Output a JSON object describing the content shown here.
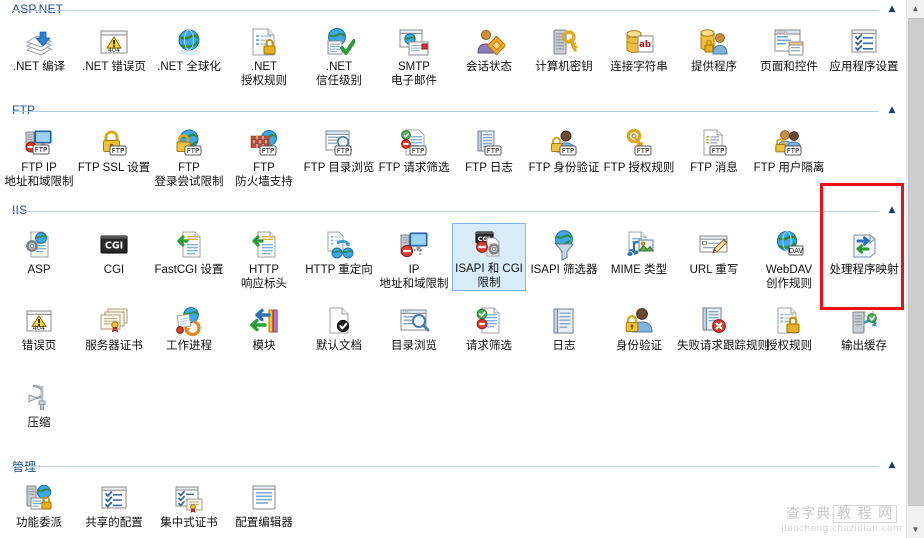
{
  "window": {
    "app": "IIS Manager Features View",
    "scrollbar": {
      "up_arrow": "▲",
      "down_arrow": "▼"
    }
  },
  "collapse_chevron": "▲",
  "groups": [
    {
      "id": "aspnet",
      "title": "ASP.NET",
      "items": [
        {
          "label": ".NET 编译",
          "icon": "net-compile-icon"
        },
        {
          "label": ".NET 错误页",
          "icon": "net-error-page-icon"
        },
        {
          "label": ".NET 全球化",
          "icon": "net-globalization-icon"
        },
        {
          "label": ".NET 授权规则",
          "icon": "net-authorization-rules-icon"
        },
        {
          "label": ".NET 信任级别",
          "icon": "net-trust-levels-icon"
        },
        {
          "label": "SMTP 电子邮件",
          "icon": "smtp-email-icon"
        },
        {
          "label": "会话状态",
          "icon": "session-state-icon"
        },
        {
          "label": "计算机密钥",
          "icon": "machine-key-icon"
        },
        {
          "label": "连接字符串",
          "icon": "connection-strings-icon"
        },
        {
          "label": "提供程序",
          "icon": "providers-icon"
        },
        {
          "label": "页面和控件",
          "icon": "pages-and-controls-icon"
        },
        {
          "label": "应用程序设置",
          "icon": "application-settings-icon"
        }
      ]
    },
    {
      "id": "ftp",
      "title": "FTP",
      "items": [
        {
          "label": "FTP IP 地址和域限制",
          "icon": "ftp-ip-address-domain-restrictions-icon"
        },
        {
          "label": "FTP SSL 设置",
          "icon": "ftp-ssl-settings-icon"
        },
        {
          "label": "FTP 登录尝试限制",
          "icon": "ftp-logon-attempt-restrictions-icon"
        },
        {
          "label": "FTP 防火墙支持",
          "icon": "ftp-firewall-support-icon"
        },
        {
          "label": "FTP 目录浏览",
          "icon": "ftp-directory-browsing-icon"
        },
        {
          "label": "FTP 请求筛选",
          "icon": "ftp-request-filtering-icon"
        },
        {
          "label": "FTP 日志",
          "icon": "ftp-logging-icon"
        },
        {
          "label": "FTP 身份验证",
          "icon": "ftp-authentication-icon"
        },
        {
          "label": "FTP 授权规则",
          "icon": "ftp-authorization-rules-icon"
        },
        {
          "label": "FTP 消息",
          "icon": "ftp-messages-icon"
        },
        {
          "label": "FTP 用户隔离",
          "icon": "ftp-user-isolation-icon"
        }
      ]
    },
    {
      "id": "iis",
      "title": "IIS",
      "items": [
        {
          "label": "ASP",
          "icon": "asp-icon"
        },
        {
          "label": "CGI",
          "icon": "cgi-icon"
        },
        {
          "label": "FastCGI 设置",
          "icon": "fastcgi-settings-icon"
        },
        {
          "label": "HTTP 响应标头",
          "icon": "http-response-headers-icon"
        },
        {
          "label": "HTTP 重定向",
          "icon": "http-redirect-icon"
        },
        {
          "label": "IP 地址和域限制",
          "icon": "ip-address-domain-restrictions-icon"
        },
        {
          "label": "ISAPI 和 CGI 限制",
          "icon": "isapi-cgi-restrictions-icon",
          "selected": true
        },
        {
          "label": "ISAPI 筛选器",
          "icon": "isapi-filters-icon"
        },
        {
          "label": "MIME 类型",
          "icon": "mime-types-icon"
        },
        {
          "label": "URL 重写",
          "icon": "url-rewrite-icon"
        },
        {
          "label": "WebDAV 创作规则",
          "icon": "webdav-authoring-rules-icon"
        },
        {
          "label": "处理程序映射",
          "icon": "handler-mappings-icon",
          "highlighted": true
        },
        {
          "label": "错误页",
          "icon": "error-pages-icon"
        },
        {
          "label": "服务器证书",
          "icon": "server-certificates-icon"
        },
        {
          "label": "工作进程",
          "icon": "worker-processes-icon"
        },
        {
          "label": "模块",
          "icon": "modules-icon"
        },
        {
          "label": "默认文档",
          "icon": "default-document-icon"
        },
        {
          "label": "目录浏览",
          "icon": "directory-browsing-icon"
        },
        {
          "label": "请求筛选",
          "icon": "request-filtering-icon"
        },
        {
          "label": "日志",
          "icon": "logging-icon"
        },
        {
          "label": "身份验证",
          "icon": "authentication-icon"
        },
        {
          "label": "失败请求跟踪规则",
          "icon": "failed-request-tracing-rules-icon"
        },
        {
          "label": "授权规则",
          "icon": "authorization-rules-icon"
        },
        {
          "label": "输出缓存",
          "icon": "output-caching-icon"
        },
        {
          "label": "压缩",
          "icon": "compression-icon"
        }
      ]
    },
    {
      "id": "manage",
      "title": "管理",
      "items": [
        {
          "label": "功能委派",
          "icon": "feature-delegation-icon"
        },
        {
          "label": "共享的配置",
          "icon": "shared-configuration-icon"
        },
        {
          "label": "集中式证书",
          "icon": "centralized-certificates-icon"
        },
        {
          "label": "配置编辑器",
          "icon": "configuration-editor-icon"
        }
      ]
    }
  ],
  "highlight": {
    "color": "#ee1111",
    "target": "处理程序映射"
  },
  "watermark": {
    "line1_left": "查字典",
    "line1_box": "教 程 网",
    "line2": "jiaocheng.chazidian.com"
  }
}
